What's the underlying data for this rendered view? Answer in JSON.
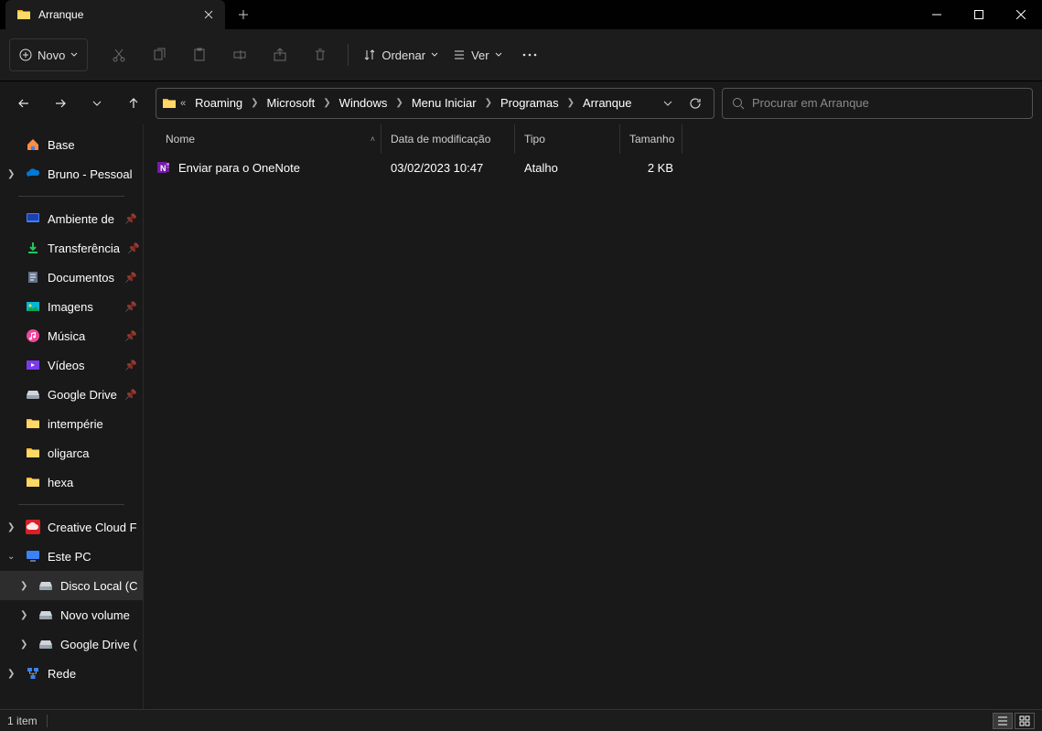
{
  "window": {
    "tab_title": "Arranque"
  },
  "toolbar": {
    "new_label": "Novo",
    "sort_label": "Ordenar",
    "view_label": "Ver"
  },
  "breadcrumb": {
    "items": [
      "Roaming",
      "Microsoft",
      "Windows",
      "Menu Iniciar",
      "Programas",
      "Arranque"
    ]
  },
  "search": {
    "placeholder": "Procurar em Arranque"
  },
  "sidebar": {
    "top": [
      {
        "label": "Base",
        "icon": "home"
      },
      {
        "label": "Bruno - Pessoal",
        "icon": "onedrive",
        "chev": "right"
      }
    ],
    "quick": [
      {
        "label": "Ambiente de",
        "icon": "desktop",
        "pin": true
      },
      {
        "label": "Transferência",
        "icon": "downloads",
        "pin": true
      },
      {
        "label": "Documentos",
        "icon": "documents",
        "pin": true
      },
      {
        "label": "Imagens",
        "icon": "pictures",
        "pin": true
      },
      {
        "label": "Música",
        "icon": "music",
        "pin": true
      },
      {
        "label": "Vídeos",
        "icon": "videos",
        "pin": true
      },
      {
        "label": "Google Drive",
        "icon": "drive-disk",
        "pin": true
      },
      {
        "label": "intempérie",
        "icon": "folder",
        "pin": false
      },
      {
        "label": "oligarca",
        "icon": "folder",
        "pin": false
      },
      {
        "label": "hexa",
        "icon": "folder",
        "pin": false
      }
    ],
    "bottom": [
      {
        "label": "Creative Cloud F",
        "icon": "cc",
        "chev": "right"
      },
      {
        "label": "Este PC",
        "icon": "pc",
        "chev": "down"
      },
      {
        "label": "Disco Local (C",
        "icon": "drive",
        "chev": "right",
        "indent": true,
        "selected": true
      },
      {
        "label": "Novo volume",
        "icon": "drive",
        "chev": "right",
        "indent": true
      },
      {
        "label": "Google Drive (",
        "icon": "drive",
        "chev": "right",
        "indent": true
      },
      {
        "label": "Rede",
        "icon": "network",
        "chev": "right"
      }
    ]
  },
  "columns": {
    "name": "Nome",
    "date": "Data de modificação",
    "type": "Tipo",
    "size": "Tamanho"
  },
  "files": [
    {
      "name": "Enviar para o OneNote",
      "date": "03/02/2023 10:47",
      "type": "Atalho",
      "size": "2 KB",
      "icon": "onenote"
    }
  ],
  "status": {
    "text": "1 item"
  }
}
